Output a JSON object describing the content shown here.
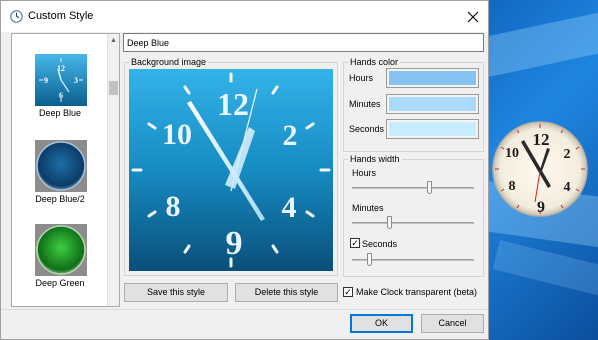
{
  "window": {
    "title": "Custom Style"
  },
  "style_list": {
    "items": [
      {
        "label": "Deep Blue",
        "selected": true,
        "clock_numbers": [
          "12",
          "3",
          "9",
          "6"
        ]
      },
      {
        "label": "Deep Blue/2"
      },
      {
        "label": "Deep Green"
      }
    ]
  },
  "style_name": {
    "value": "Deep Blue"
  },
  "background": {
    "title": "Background image",
    "numerals": [
      "12",
      "2",
      "4",
      "9",
      "8",
      "10"
    ]
  },
  "hands_color": {
    "title": "Hands color",
    "rows": [
      {
        "label": "Hours",
        "color": "#86c2f2"
      },
      {
        "label": "Minutes",
        "color": "#a9d9fb"
      },
      {
        "label": "Seconds",
        "color": "#c6ecfd"
      }
    ]
  },
  "hands_width": {
    "title": "Hands width",
    "hours_label": "Hours",
    "hours_value": 0.64,
    "minutes_label": "Minutes",
    "minutes_value": 0.3,
    "seconds_label": "Seconds",
    "seconds_checked": true,
    "seconds_value": 0.13
  },
  "buttons": {
    "save": "Save this style",
    "delete": "Delete this style",
    "ok": "OK",
    "cancel": "Cancel"
  },
  "transparent": {
    "label": "Make Clock transparent (beta)",
    "checked": true
  },
  "desktop_clock": {
    "numerals": [
      "12",
      "2",
      "4",
      "10",
      "8",
      "9"
    ]
  },
  "colors": {
    "accent": "#0078d7",
    "preview_bg": "#1a8fc6"
  }
}
